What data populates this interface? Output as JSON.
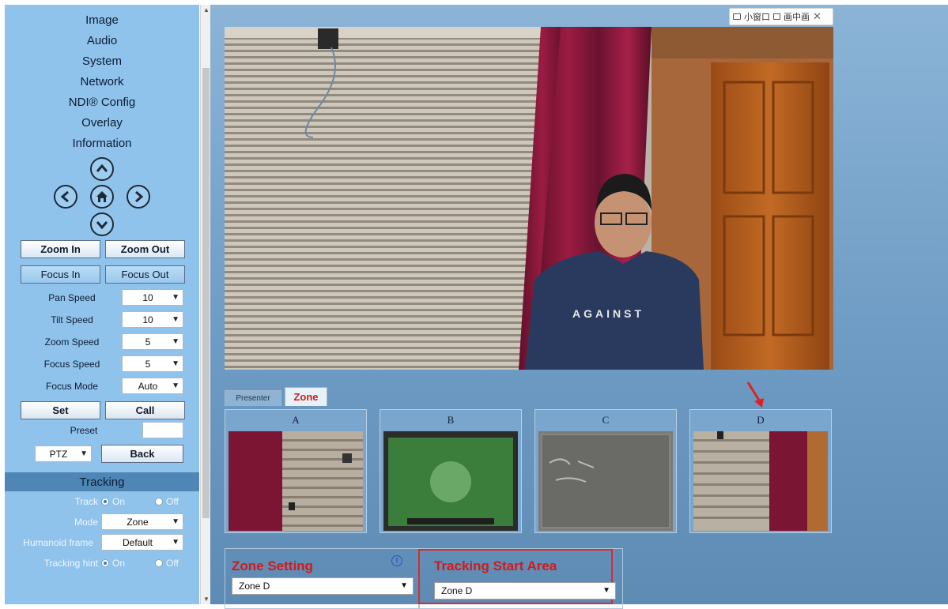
{
  "sidebar": {
    "menu": [
      "Image",
      "Audio",
      "System",
      "Network",
      "NDI® Config",
      "Overlay",
      "Information"
    ],
    "ptz_icons": {
      "up": "arrow-up-icon",
      "left": "arrow-left-icon",
      "home": "home-icon",
      "right": "arrow-right-icon",
      "down": "arrow-down-icon"
    },
    "zoom_in": "Zoom In",
    "zoom_out": "Zoom Out",
    "focus_in": "Focus In",
    "focus_out": "Focus Out",
    "settings": [
      {
        "label": "Pan Speed",
        "value": "10"
      },
      {
        "label": "Tilt Speed",
        "value": "10"
      },
      {
        "label": "Zoom Speed",
        "value": "5"
      },
      {
        "label": "Focus Speed",
        "value": "5"
      },
      {
        "label": "Focus Mode",
        "value": "Auto"
      }
    ],
    "set": "Set",
    "call": "Call",
    "preset_label": "Preset",
    "preset_value": "",
    "mode_select": "PTZ",
    "back": "Back"
  },
  "tracking": {
    "title": "Tracking",
    "track_label": "Track",
    "track_on": "On",
    "track_off": "Off",
    "mode_label": "Mode",
    "mode_value": "Zone",
    "humanoid_label": "Humanoid frame",
    "humanoid_value": "Default",
    "hint_label": "Tracking hint",
    "hint_on": "On",
    "hint_off": "Off"
  },
  "overlay_toolbar": {
    "item1": "小窗口",
    "item2": "画中画"
  },
  "tabs": {
    "presenter": "Presenter",
    "zone": "Zone"
  },
  "zones": [
    "A",
    "B",
    "C",
    "D"
  ],
  "zone_setting": {
    "title": "Zone Setting",
    "value": "Zone D",
    "info_icon": "info-icon"
  },
  "start_area": {
    "title": "Tracking Start Area",
    "value": "Zone D"
  },
  "colors": {
    "accent_red": "#d11a1a",
    "sidebar_bg": "#8fc3ec",
    "tracking_band": "#4f86b6"
  }
}
